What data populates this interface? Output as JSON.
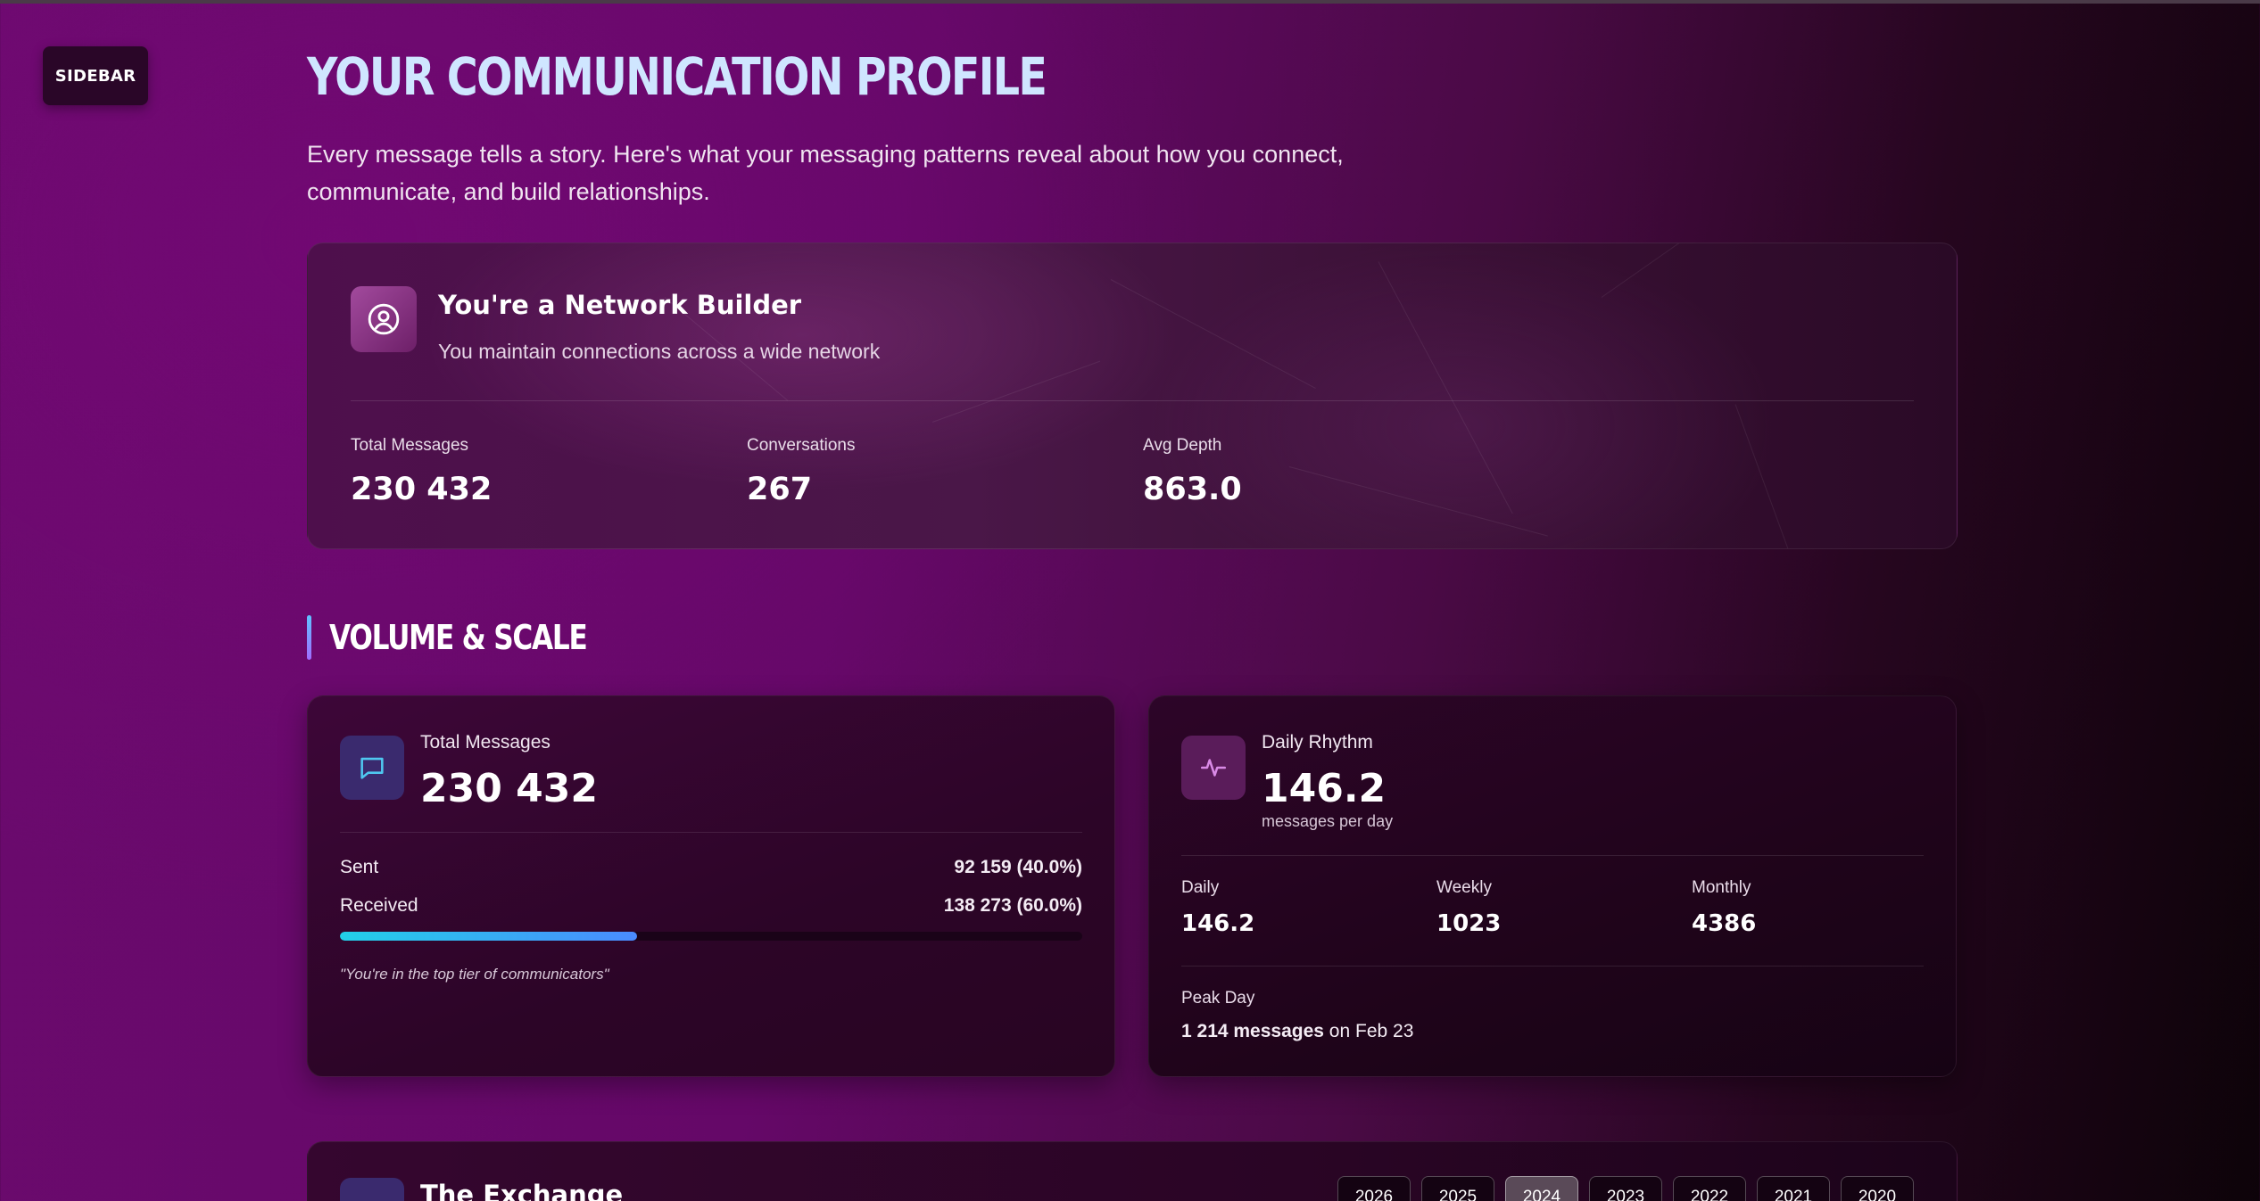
{
  "sidebar": {
    "label": "SIDEBAR"
  },
  "header": {
    "title": "YOUR COMMUNICATION PROFILE",
    "intro": "Every message tells a story. Here's what your messaging patterns reveal about how you connect, communicate, and build relationships."
  },
  "profile": {
    "icon": "user-circle-icon",
    "title": "You're a Network Builder",
    "subtitle": "You maintain connections across a wide network",
    "stats": [
      {
        "label": "Total Messages",
        "value": "230 432"
      },
      {
        "label": "Conversations",
        "value": "267"
      },
      {
        "label": "Avg Depth",
        "value": "863.0"
      }
    ]
  },
  "volume_section": {
    "title": "VOLUME & SCALE"
  },
  "total_card": {
    "icon": "message-icon",
    "label": "Total Messages",
    "value": "230 432",
    "sent_label": "Sent",
    "sent_value": "92 159 (40.0%)",
    "received_label": "Received",
    "received_value": "138 273 (60.0%)",
    "sent_fraction": 0.4,
    "quote": "\"You're in the top tier of communicators\""
  },
  "rhythm_card": {
    "icon": "activity-icon",
    "label": "Daily Rhythm",
    "value": "146.2",
    "unit": "messages per day",
    "stats": [
      {
        "label": "Daily",
        "value": "146.2"
      },
      {
        "label": "Weekly",
        "value": "1023"
      },
      {
        "label": "Monthly",
        "value": "4386"
      }
    ],
    "peak_label": "Peak Day",
    "peak_count": "1 214 messages",
    "peak_suffix": " on Feb 23"
  },
  "exchange": {
    "title": "The Exchange",
    "years": [
      "2026",
      "2025",
      "2024",
      "2023",
      "2022",
      "2021",
      "2020"
    ],
    "active_year": "2024"
  },
  "colors": {
    "accent": "#cfe6ff",
    "progress_start": "#22d0e8",
    "progress_end": "#4a8bff"
  }
}
